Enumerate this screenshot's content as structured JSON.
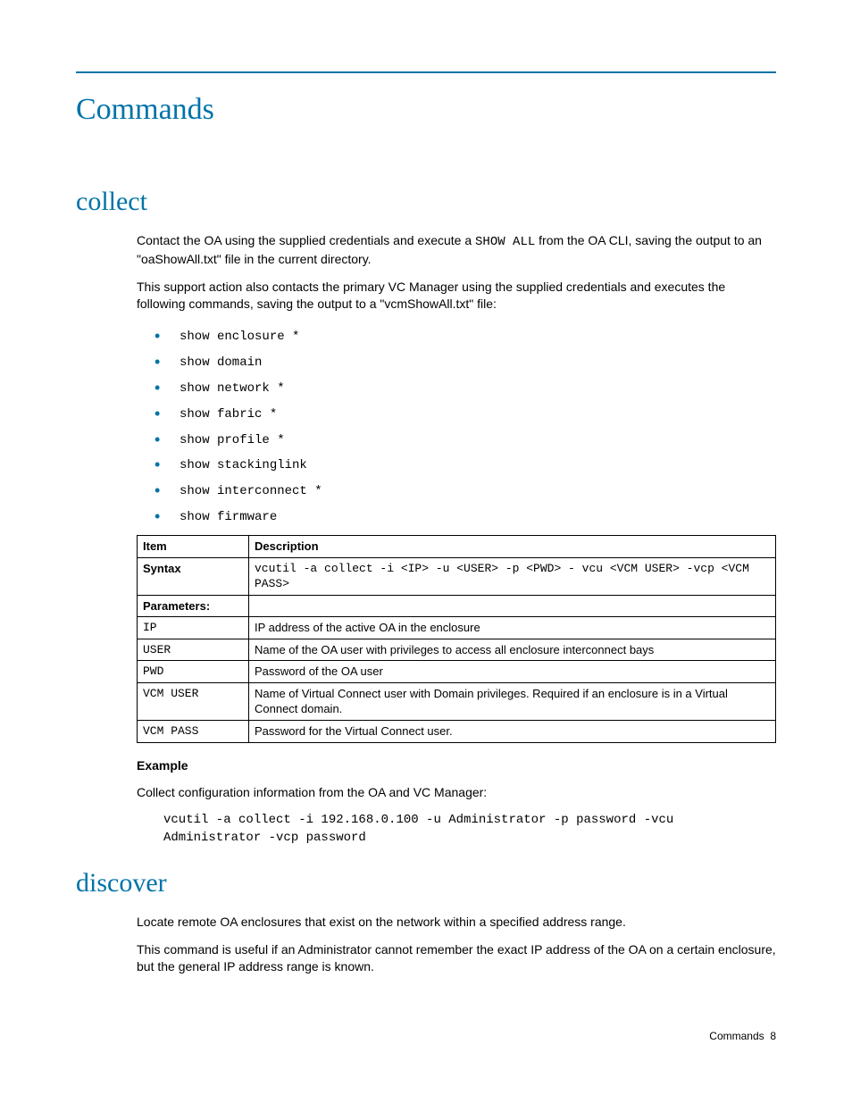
{
  "page": {
    "title": "Commands",
    "footer_label": "Commands",
    "footer_page": "8"
  },
  "collect": {
    "heading": "collect",
    "para1_pre": "Contact the OA using the supplied credentials and execute a ",
    "para1_code": "SHOW ALL",
    "para1_post": " from the OA CLI, saving the output to an \"oaShowAll.txt\" file in the current directory.",
    "para2": "This support action also contacts the primary VC Manager using the supplied credentials and executes the following commands, saving the output to a \"vcmShowAll.txt\" file:",
    "commands": [
      "show enclosure *",
      "show domain",
      "show network *",
      "show fabric *",
      "show profile *",
      "show stackinglink",
      "show interconnect *",
      "show firmware"
    ],
    "table": {
      "head_item": "Item",
      "head_desc": "Description",
      "rows": [
        {
          "item": "Syntax",
          "item_bold": true,
          "item_mono": false,
          "desc_mono": true,
          "desc": "vcutil -a collect -i <IP> -u <USER> -p <PWD> - vcu <VCM USER> -vcp <VCM PASS>"
        },
        {
          "item": "Parameters:",
          "item_bold": true,
          "item_mono": false,
          "desc_mono": false,
          "desc": ""
        },
        {
          "item": "IP",
          "item_bold": false,
          "item_mono": true,
          "desc_mono": false,
          "desc": "IP address of the active OA in the enclosure"
        },
        {
          "item": "USER",
          "item_bold": false,
          "item_mono": true,
          "desc_mono": false,
          "desc": "Name of the OA user with privileges to access all enclosure interconnect bays"
        },
        {
          "item": "PWD",
          "item_bold": false,
          "item_mono": true,
          "desc_mono": false,
          "desc": "Password of the OA user"
        },
        {
          "item": "VCM USER",
          "item_bold": false,
          "item_mono": true,
          "desc_mono": false,
          "desc": "Name of Virtual Connect user with Domain privileges. Required if an enclosure is in a Virtual Connect domain."
        },
        {
          "item": "VCM PASS",
          "item_bold": false,
          "item_mono": true,
          "desc_mono": false,
          "desc": "Password for the Virtual Connect user."
        }
      ]
    },
    "example_label": "Example",
    "example_text": "Collect configuration information from the OA and VC Manager:",
    "example_code_l1": "vcutil -a collect -i 192.168.0.100 -u Administrator -p password -vcu",
    "example_code_l2": "Administrator -vcp password"
  },
  "discover": {
    "heading": "discover",
    "para1": "Locate remote OA enclosures that exist on the network within a specified address range.",
    "para2": "This command is useful if an Administrator cannot remember the exact IP address of the OA on a certain enclosure, but the general IP address range is known."
  }
}
